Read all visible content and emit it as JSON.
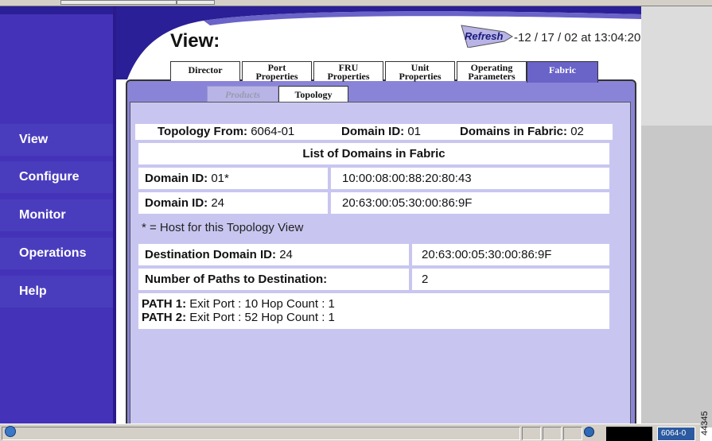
{
  "nav": {
    "items": [
      {
        "label": "View"
      },
      {
        "label": "Configure"
      },
      {
        "label": "Monitor"
      },
      {
        "label": "Operations"
      },
      {
        "label": "Help"
      }
    ]
  },
  "header": {
    "title": "View:",
    "refresh_label": "Refresh",
    "timestamp": "-12 / 17 / 02 at 13:04:20"
  },
  "tabs": [
    {
      "line1": "Director",
      "line2": ""
    },
    {
      "line1": "Port",
      "line2": "Properties"
    },
    {
      "line1": "FRU",
      "line2": "Properties"
    },
    {
      "line1": "Unit",
      "line2": "Properties"
    },
    {
      "line1": "Operating",
      "line2": "Parameters"
    },
    {
      "line1": "Fabric",
      "line2": "",
      "active": true
    }
  ],
  "subtabs": {
    "products": "Products",
    "topology": "Topology"
  },
  "summary": {
    "topology_from_label": "Topology From:",
    "topology_from_value": "6064-01",
    "domain_id_label": "Domain ID:",
    "domain_id_value": "01",
    "domains_in_fabric_label": "Domains in Fabric:",
    "domains_in_fabric_value": "02"
  },
  "domains_list": {
    "heading": "List of Domains in Fabric",
    "rows": [
      {
        "label": "Domain ID:",
        "id": "01*",
        "wwn": "10:00:08:00:88:20:80:43"
      },
      {
        "label": "Domain ID:",
        "id": "24",
        "wwn": "20:63:00:05:30:00:86:9F"
      }
    ],
    "footnote": "* = Host for this Topology View"
  },
  "destination": {
    "domain_label": "Destination Domain ID:",
    "domain_value": "24",
    "domain_wwn": "20:63:00:05:30:00:86:9F",
    "paths_label": "Number of Paths to Destination:",
    "paths_value": "2"
  },
  "paths": [
    {
      "label": "PATH 1:",
      "text": "Exit Port :  10 Hop Count : 1"
    },
    {
      "label": "PATH 2:",
      "text": "Exit Port :  52 Hop Count : 1"
    }
  ],
  "statusbar": {
    "task_label": "6064-0",
    "figure_number": "44345"
  },
  "colors": {
    "nav_bg": "#4433b8",
    "panel_bg": "#c8c6f0",
    "tab_active": "#6a63c8"
  }
}
